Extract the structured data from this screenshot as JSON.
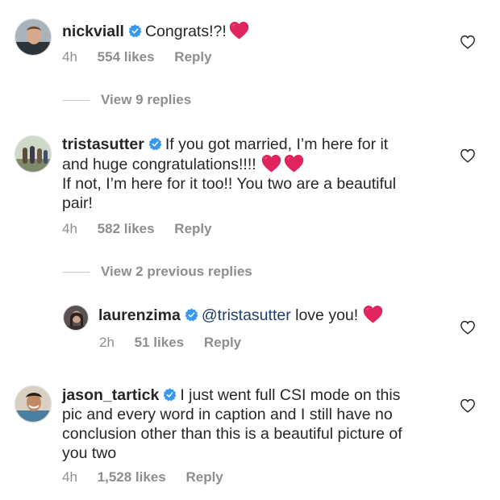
{
  "comments": [
    {
      "username": "nickviall",
      "text": "Congrats!?!",
      "time": "4h",
      "likes": "554 likes",
      "reply": "Reply"
    },
    {
      "username": "tristasutter",
      "text_line1": "If you got married, I’m here for it",
      "text_line2": "and huge congratulations!!!!",
      "text_line3": "If not, I’m here for it too!! You two are a beautiful",
      "text_line4": "pair!",
      "time": "4h",
      "likes": "582 likes",
      "reply": "Reply"
    },
    {
      "username": "jason_tartick",
      "text_line1": "I just went full CSI mode on this",
      "text_line2": "pic and every word in caption and I still have no",
      "text_line3": "conclusion other than this is a beautiful picture of",
      "text_line4": "you two",
      "time": "4h",
      "likes": "1,528 likes",
      "reply": "Reply"
    }
  ],
  "replies_link_1": "View 9 replies",
  "replies_link_2": "View 2 previous replies",
  "reply_comment": {
    "username": "laurenzima",
    "mention": "@tristasutter",
    "text": "love you!",
    "time": "2h",
    "likes": "51 likes",
    "reply": "Reply"
  },
  "icons": {
    "verified_color": "#3897f0",
    "heart_color": "#e0245e",
    "like_outline_color": "#262626"
  }
}
